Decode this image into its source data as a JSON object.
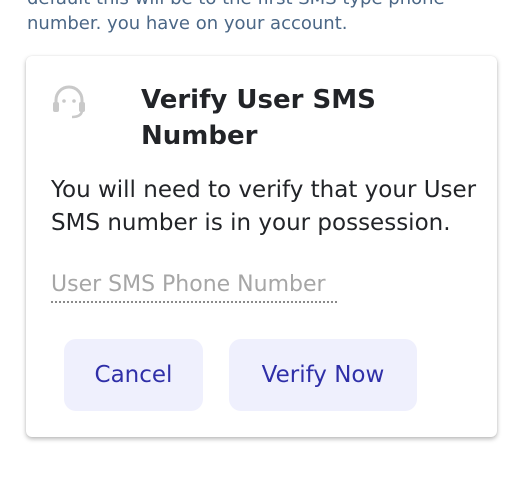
{
  "background": {
    "lines": [
      "default this will be to the first SMS type phone",
      "number. you have on your account."
    ]
  },
  "dialog": {
    "icon": "support-agent-icon",
    "title": "Verify User SMS Number",
    "message": "You will need to verify that your User SMS number is in your possession.",
    "input": {
      "placeholder": "User SMS Phone Number",
      "value": ""
    },
    "buttons": {
      "cancel": "Cancel",
      "verify": "Verify Now"
    }
  },
  "colors": {
    "accent": "#2f2fa8",
    "button_bg": "#eff0fd",
    "background_text": "#4b6786",
    "text": "#222428"
  }
}
